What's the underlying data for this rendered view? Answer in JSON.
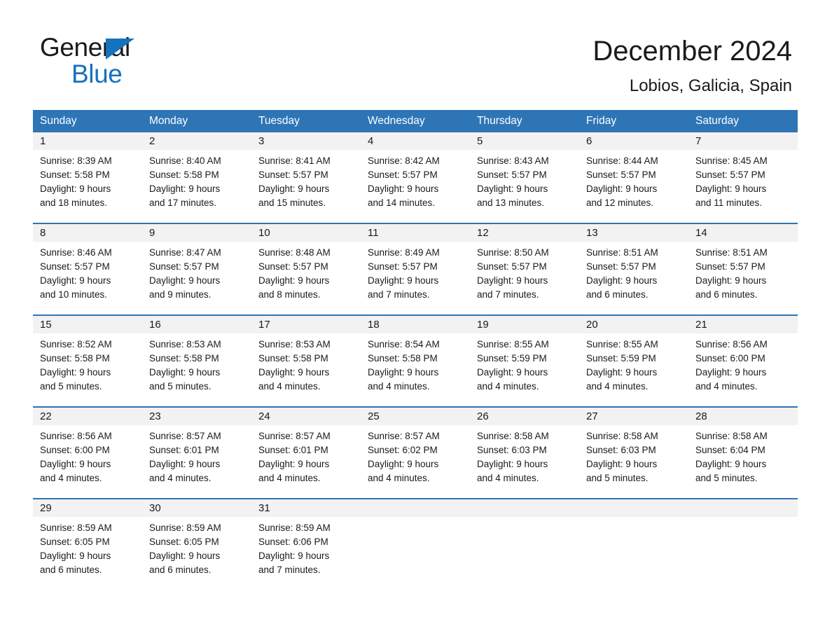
{
  "brand": {
    "name_part1": "General",
    "name_part2": "Blue",
    "accent_color": "#1572bd"
  },
  "header": {
    "title": "December 2024",
    "subtitle": "Lobios, Galicia, Spain",
    "header_bar_color": "#2e75b6",
    "day_band_color": "#f2f2f2"
  },
  "weekday_headers": [
    "Sunday",
    "Monday",
    "Tuesday",
    "Wednesday",
    "Thursday",
    "Friday",
    "Saturday"
  ],
  "weeks": [
    {
      "days": [
        {
          "num": "1",
          "sunrise": "Sunrise: 8:39 AM",
          "sunset": "Sunset: 5:58 PM",
          "daylight_line1": "Daylight: 9 hours",
          "daylight_line2": "and 18 minutes."
        },
        {
          "num": "2",
          "sunrise": "Sunrise: 8:40 AM",
          "sunset": "Sunset: 5:58 PM",
          "daylight_line1": "Daylight: 9 hours",
          "daylight_line2": "and 17 minutes."
        },
        {
          "num": "3",
          "sunrise": "Sunrise: 8:41 AM",
          "sunset": "Sunset: 5:57 PM",
          "daylight_line1": "Daylight: 9 hours",
          "daylight_line2": "and 15 minutes."
        },
        {
          "num": "4",
          "sunrise": "Sunrise: 8:42 AM",
          "sunset": "Sunset: 5:57 PM",
          "daylight_line1": "Daylight: 9 hours",
          "daylight_line2": "and 14 minutes."
        },
        {
          "num": "5",
          "sunrise": "Sunrise: 8:43 AM",
          "sunset": "Sunset: 5:57 PM",
          "daylight_line1": "Daylight: 9 hours",
          "daylight_line2": "and 13 minutes."
        },
        {
          "num": "6",
          "sunrise": "Sunrise: 8:44 AM",
          "sunset": "Sunset: 5:57 PM",
          "daylight_line1": "Daylight: 9 hours",
          "daylight_line2": "and 12 minutes."
        },
        {
          "num": "7",
          "sunrise": "Sunrise: 8:45 AM",
          "sunset": "Sunset: 5:57 PM",
          "daylight_line1": "Daylight: 9 hours",
          "daylight_line2": "and 11 minutes."
        }
      ]
    },
    {
      "days": [
        {
          "num": "8",
          "sunrise": "Sunrise: 8:46 AM",
          "sunset": "Sunset: 5:57 PM",
          "daylight_line1": "Daylight: 9 hours",
          "daylight_line2": "and 10 minutes."
        },
        {
          "num": "9",
          "sunrise": "Sunrise: 8:47 AM",
          "sunset": "Sunset: 5:57 PM",
          "daylight_line1": "Daylight: 9 hours",
          "daylight_line2": "and 9 minutes."
        },
        {
          "num": "10",
          "sunrise": "Sunrise: 8:48 AM",
          "sunset": "Sunset: 5:57 PM",
          "daylight_line1": "Daylight: 9 hours",
          "daylight_line2": "and 8 minutes."
        },
        {
          "num": "11",
          "sunrise": "Sunrise: 8:49 AM",
          "sunset": "Sunset: 5:57 PM",
          "daylight_line1": "Daylight: 9 hours",
          "daylight_line2": "and 7 minutes."
        },
        {
          "num": "12",
          "sunrise": "Sunrise: 8:50 AM",
          "sunset": "Sunset: 5:57 PM",
          "daylight_line1": "Daylight: 9 hours",
          "daylight_line2": "and 7 minutes."
        },
        {
          "num": "13",
          "sunrise": "Sunrise: 8:51 AM",
          "sunset": "Sunset: 5:57 PM",
          "daylight_line1": "Daylight: 9 hours",
          "daylight_line2": "and 6 minutes."
        },
        {
          "num": "14",
          "sunrise": "Sunrise: 8:51 AM",
          "sunset": "Sunset: 5:57 PM",
          "daylight_line1": "Daylight: 9 hours",
          "daylight_line2": "and 6 minutes."
        }
      ]
    },
    {
      "days": [
        {
          "num": "15",
          "sunrise": "Sunrise: 8:52 AM",
          "sunset": "Sunset: 5:58 PM",
          "daylight_line1": "Daylight: 9 hours",
          "daylight_line2": "and 5 minutes."
        },
        {
          "num": "16",
          "sunrise": "Sunrise: 8:53 AM",
          "sunset": "Sunset: 5:58 PM",
          "daylight_line1": "Daylight: 9 hours",
          "daylight_line2": "and 5 minutes."
        },
        {
          "num": "17",
          "sunrise": "Sunrise: 8:53 AM",
          "sunset": "Sunset: 5:58 PM",
          "daylight_line1": "Daylight: 9 hours",
          "daylight_line2": "and 4 minutes."
        },
        {
          "num": "18",
          "sunrise": "Sunrise: 8:54 AM",
          "sunset": "Sunset: 5:58 PM",
          "daylight_line1": "Daylight: 9 hours",
          "daylight_line2": "and 4 minutes."
        },
        {
          "num": "19",
          "sunrise": "Sunrise: 8:55 AM",
          "sunset": "Sunset: 5:59 PM",
          "daylight_line1": "Daylight: 9 hours",
          "daylight_line2": "and 4 minutes."
        },
        {
          "num": "20",
          "sunrise": "Sunrise: 8:55 AM",
          "sunset": "Sunset: 5:59 PM",
          "daylight_line1": "Daylight: 9 hours",
          "daylight_line2": "and 4 minutes."
        },
        {
          "num": "21",
          "sunrise": "Sunrise: 8:56 AM",
          "sunset": "Sunset: 6:00 PM",
          "daylight_line1": "Daylight: 9 hours",
          "daylight_line2": "and 4 minutes."
        }
      ]
    },
    {
      "days": [
        {
          "num": "22",
          "sunrise": "Sunrise: 8:56 AM",
          "sunset": "Sunset: 6:00 PM",
          "daylight_line1": "Daylight: 9 hours",
          "daylight_line2": "and 4 minutes."
        },
        {
          "num": "23",
          "sunrise": "Sunrise: 8:57 AM",
          "sunset": "Sunset: 6:01 PM",
          "daylight_line1": "Daylight: 9 hours",
          "daylight_line2": "and 4 minutes."
        },
        {
          "num": "24",
          "sunrise": "Sunrise: 8:57 AM",
          "sunset": "Sunset: 6:01 PM",
          "daylight_line1": "Daylight: 9 hours",
          "daylight_line2": "and 4 minutes."
        },
        {
          "num": "25",
          "sunrise": "Sunrise: 8:57 AM",
          "sunset": "Sunset: 6:02 PM",
          "daylight_line1": "Daylight: 9 hours",
          "daylight_line2": "and 4 minutes."
        },
        {
          "num": "26",
          "sunrise": "Sunrise: 8:58 AM",
          "sunset": "Sunset: 6:03 PM",
          "daylight_line1": "Daylight: 9 hours",
          "daylight_line2": "and 4 minutes."
        },
        {
          "num": "27",
          "sunrise": "Sunrise: 8:58 AM",
          "sunset": "Sunset: 6:03 PM",
          "daylight_line1": "Daylight: 9 hours",
          "daylight_line2": "and 5 minutes."
        },
        {
          "num": "28",
          "sunrise": "Sunrise: 8:58 AM",
          "sunset": "Sunset: 6:04 PM",
          "daylight_line1": "Daylight: 9 hours",
          "daylight_line2": "and 5 minutes."
        }
      ]
    },
    {
      "days": [
        {
          "num": "29",
          "sunrise": "Sunrise: 8:59 AM",
          "sunset": "Sunset: 6:05 PM",
          "daylight_line1": "Daylight: 9 hours",
          "daylight_line2": "and 6 minutes."
        },
        {
          "num": "30",
          "sunrise": "Sunrise: 8:59 AM",
          "sunset": "Sunset: 6:05 PM",
          "daylight_line1": "Daylight: 9 hours",
          "daylight_line2": "and 6 minutes."
        },
        {
          "num": "31",
          "sunrise": "Sunrise: 8:59 AM",
          "sunset": "Sunset: 6:06 PM",
          "daylight_line1": "Daylight: 9 hours",
          "daylight_line2": "and 7 minutes."
        },
        {
          "num": "",
          "sunrise": "",
          "sunset": "",
          "daylight_line1": "",
          "daylight_line2": ""
        },
        {
          "num": "",
          "sunrise": "",
          "sunset": "",
          "daylight_line1": "",
          "daylight_line2": ""
        },
        {
          "num": "",
          "sunrise": "",
          "sunset": "",
          "daylight_line1": "",
          "daylight_line2": ""
        },
        {
          "num": "",
          "sunrise": "",
          "sunset": "",
          "daylight_line1": "",
          "daylight_line2": ""
        }
      ]
    }
  ]
}
